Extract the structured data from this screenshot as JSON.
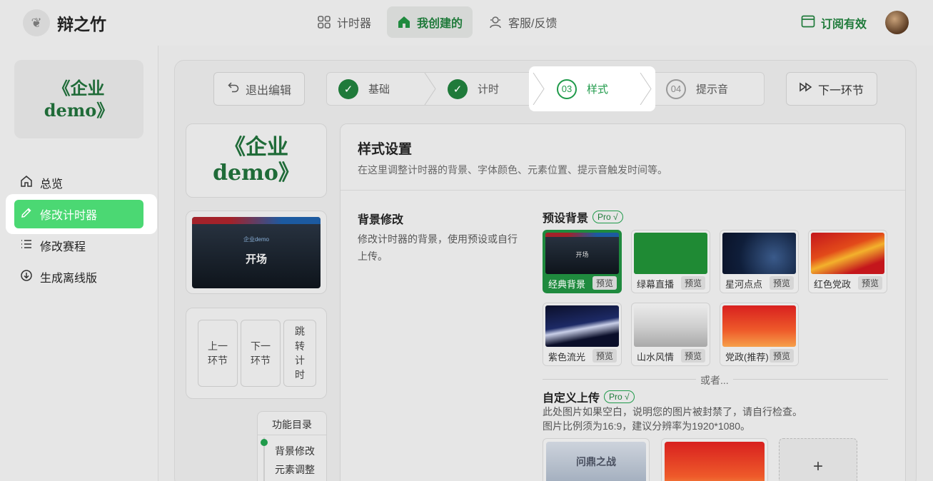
{
  "brand": {
    "name": "辩之竹",
    "logo_icon": "bamboo-logo-icon"
  },
  "nav": {
    "items": [
      {
        "label": "计时器",
        "icon": "grid-icon"
      },
      {
        "label": "我创建的",
        "icon": "home-icon"
      },
      {
        "label": "客服/反馈",
        "icon": "support-icon"
      }
    ],
    "subscribe_label": "订阅有效"
  },
  "sidebar": {
    "project_title": "《企业\ndemo》",
    "items": [
      {
        "label": "总览",
        "icon": "home-icon"
      },
      {
        "label": "修改计时器",
        "icon": "pencil-icon"
      },
      {
        "label": "修改赛程",
        "icon": "list-icon"
      },
      {
        "label": "生成离线版",
        "icon": "download-icon"
      }
    ]
  },
  "toolbar": {
    "exit_label": "退出编辑",
    "next_label": "下一环节",
    "steps": [
      {
        "num": "✓",
        "label": "基础"
      },
      {
        "num": "✓",
        "label": "计时"
      },
      {
        "num": "03",
        "label": "样式"
      },
      {
        "num": "04",
        "label": "提示音"
      }
    ]
  },
  "preview": {
    "title": "《企业\ndemo》",
    "screen_sub": "企业demo",
    "screen_main": "开场",
    "controls": [
      "上一\n环节",
      "下一\n环节",
      "跳\n转\n计\n时"
    ]
  },
  "toc": {
    "title": "功能目录",
    "items": [
      "背景修改",
      "元素调整"
    ]
  },
  "panel": {
    "title": "样式设置",
    "desc": "在这里调整计时器的背景、字体颜色、元素位置、提示音触发时间等。",
    "section_title": "背景修改",
    "section_desc": "修改计时器的背景，使用预设或自行上传。",
    "preset_title": "预设背景",
    "pro_tag": "Pro √",
    "preview_label": "预览",
    "presets": [
      {
        "name": "经典背景"
      },
      {
        "name": "绿幕直播"
      },
      {
        "name": "星河点点"
      },
      {
        "name": "红色党政"
      },
      {
        "name": "紫色流光"
      },
      {
        "name": "山水风情"
      },
      {
        "name": "党政(推荐)"
      }
    ],
    "or_text": "或者...",
    "custom_title": "自定义上传",
    "custom_desc_1": "此处图片如果空白，说明您的图片被封禁了，请自行检查。",
    "custom_desc_2": "图片比例须为16:9，建议分辨率为1920*1080。",
    "upload_1_text": "问鼎之战",
    "add_label": "+"
  }
}
